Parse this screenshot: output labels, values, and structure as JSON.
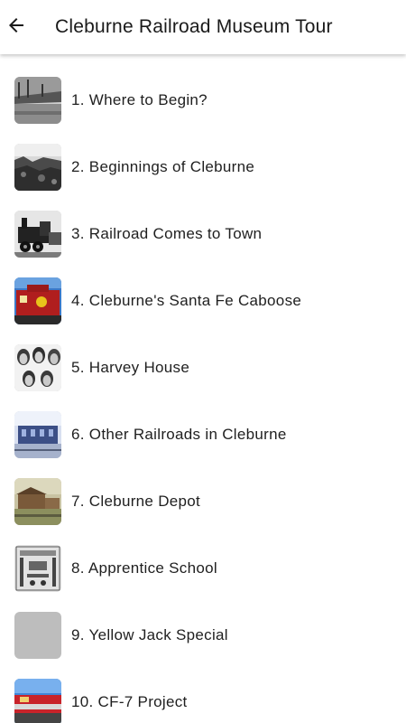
{
  "header": {
    "title": "Cleburne Railroad Museum Tour",
    "back_icon": "arrow-left-icon"
  },
  "tour": {
    "items": [
      {
        "label": "1. Where to Begin?",
        "thumb": "bw-town-photo"
      },
      {
        "label": "2. Beginnings of Cleburne",
        "thumb": "bw-ruins-photo"
      },
      {
        "label": "3. Railroad Comes to Town",
        "thumb": "bw-locomotive-photo"
      },
      {
        "label": "4. Cleburne's Santa Fe Caboose",
        "thumb": "red-caboose-photo"
      },
      {
        "label": "5. Harvey House",
        "thumb": "bw-portraits-photo"
      },
      {
        "label": "6. Other Railroads in Cleburne",
        "thumb": "blue-depot-photo"
      },
      {
        "label": "7. Cleburne Depot",
        "thumb": "sepia-depot-photo"
      },
      {
        "label": "8. Apprentice School",
        "thumb": "bw-workshop-photo"
      },
      {
        "label": "9. Yellow Jack Special",
        "thumb": "placeholder-image"
      },
      {
        "label": "10. CF-7 Project",
        "thumb": "red-locomotive-photo"
      }
    ]
  },
  "colors": {
    "text": "#1f1f1f",
    "placeholder": "#bdbdbd",
    "santa_fe_red": "#b01e1e",
    "santa_fe_yellow": "#e8c21b"
  }
}
